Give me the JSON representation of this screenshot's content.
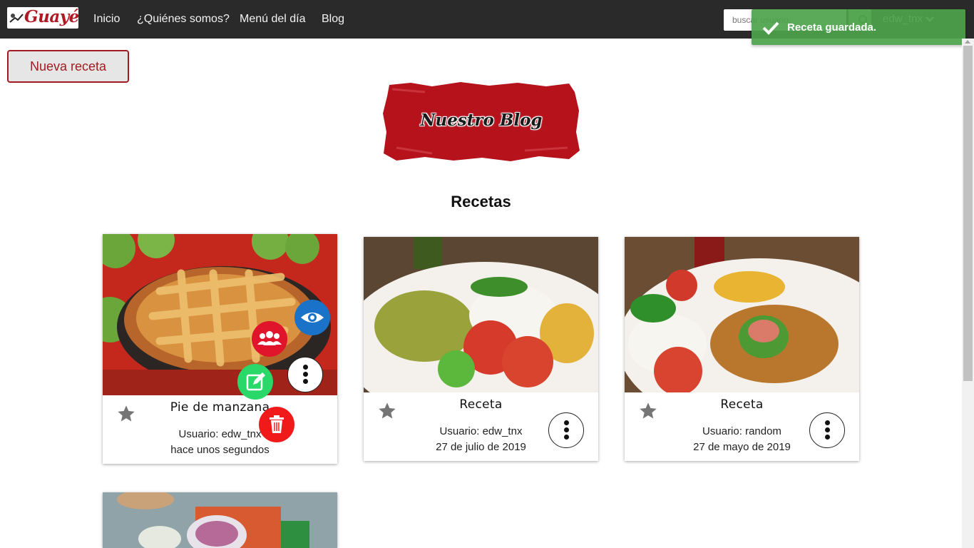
{
  "navbar": {
    "logo_text": "Guayé",
    "links": [
      "Inicio",
      "¿Quiénes somos?",
      "Menú del día",
      "Blog"
    ],
    "search_placeholder": "buscar usuario",
    "user": "edw_tnx"
  },
  "toast": {
    "message": "Receta guardada."
  },
  "new_recipe_label": "Nueva receta",
  "banner_title": "Nuestro Blog",
  "section_title": "Recetas",
  "recipes": [
    {
      "title": "Pie de manzana",
      "user": "Usuario: edw_tnx",
      "date": "hace unos segundos",
      "actions_open": true
    },
    {
      "title": "Receta",
      "user": "Usuario: edw_tnx",
      "date": "27 de julio de 2019",
      "actions_open": false
    },
    {
      "title": "Receta",
      "user": "Usuario: random",
      "date": "27 de mayo de 2019",
      "actions_open": false
    }
  ],
  "fab_actions": [
    "eye-icon",
    "group-icon",
    "edit-icon",
    "trash-icon"
  ],
  "colors": {
    "navbar": "#2a2a2a",
    "brand_red": "#a31b22",
    "toast_green": "#4ca34c",
    "fab_view": "#1a73c8",
    "fab_group": "#e0142a",
    "fab_edit": "#2ad86a",
    "fab_delete": "#f01a1a",
    "star": "#757575"
  }
}
